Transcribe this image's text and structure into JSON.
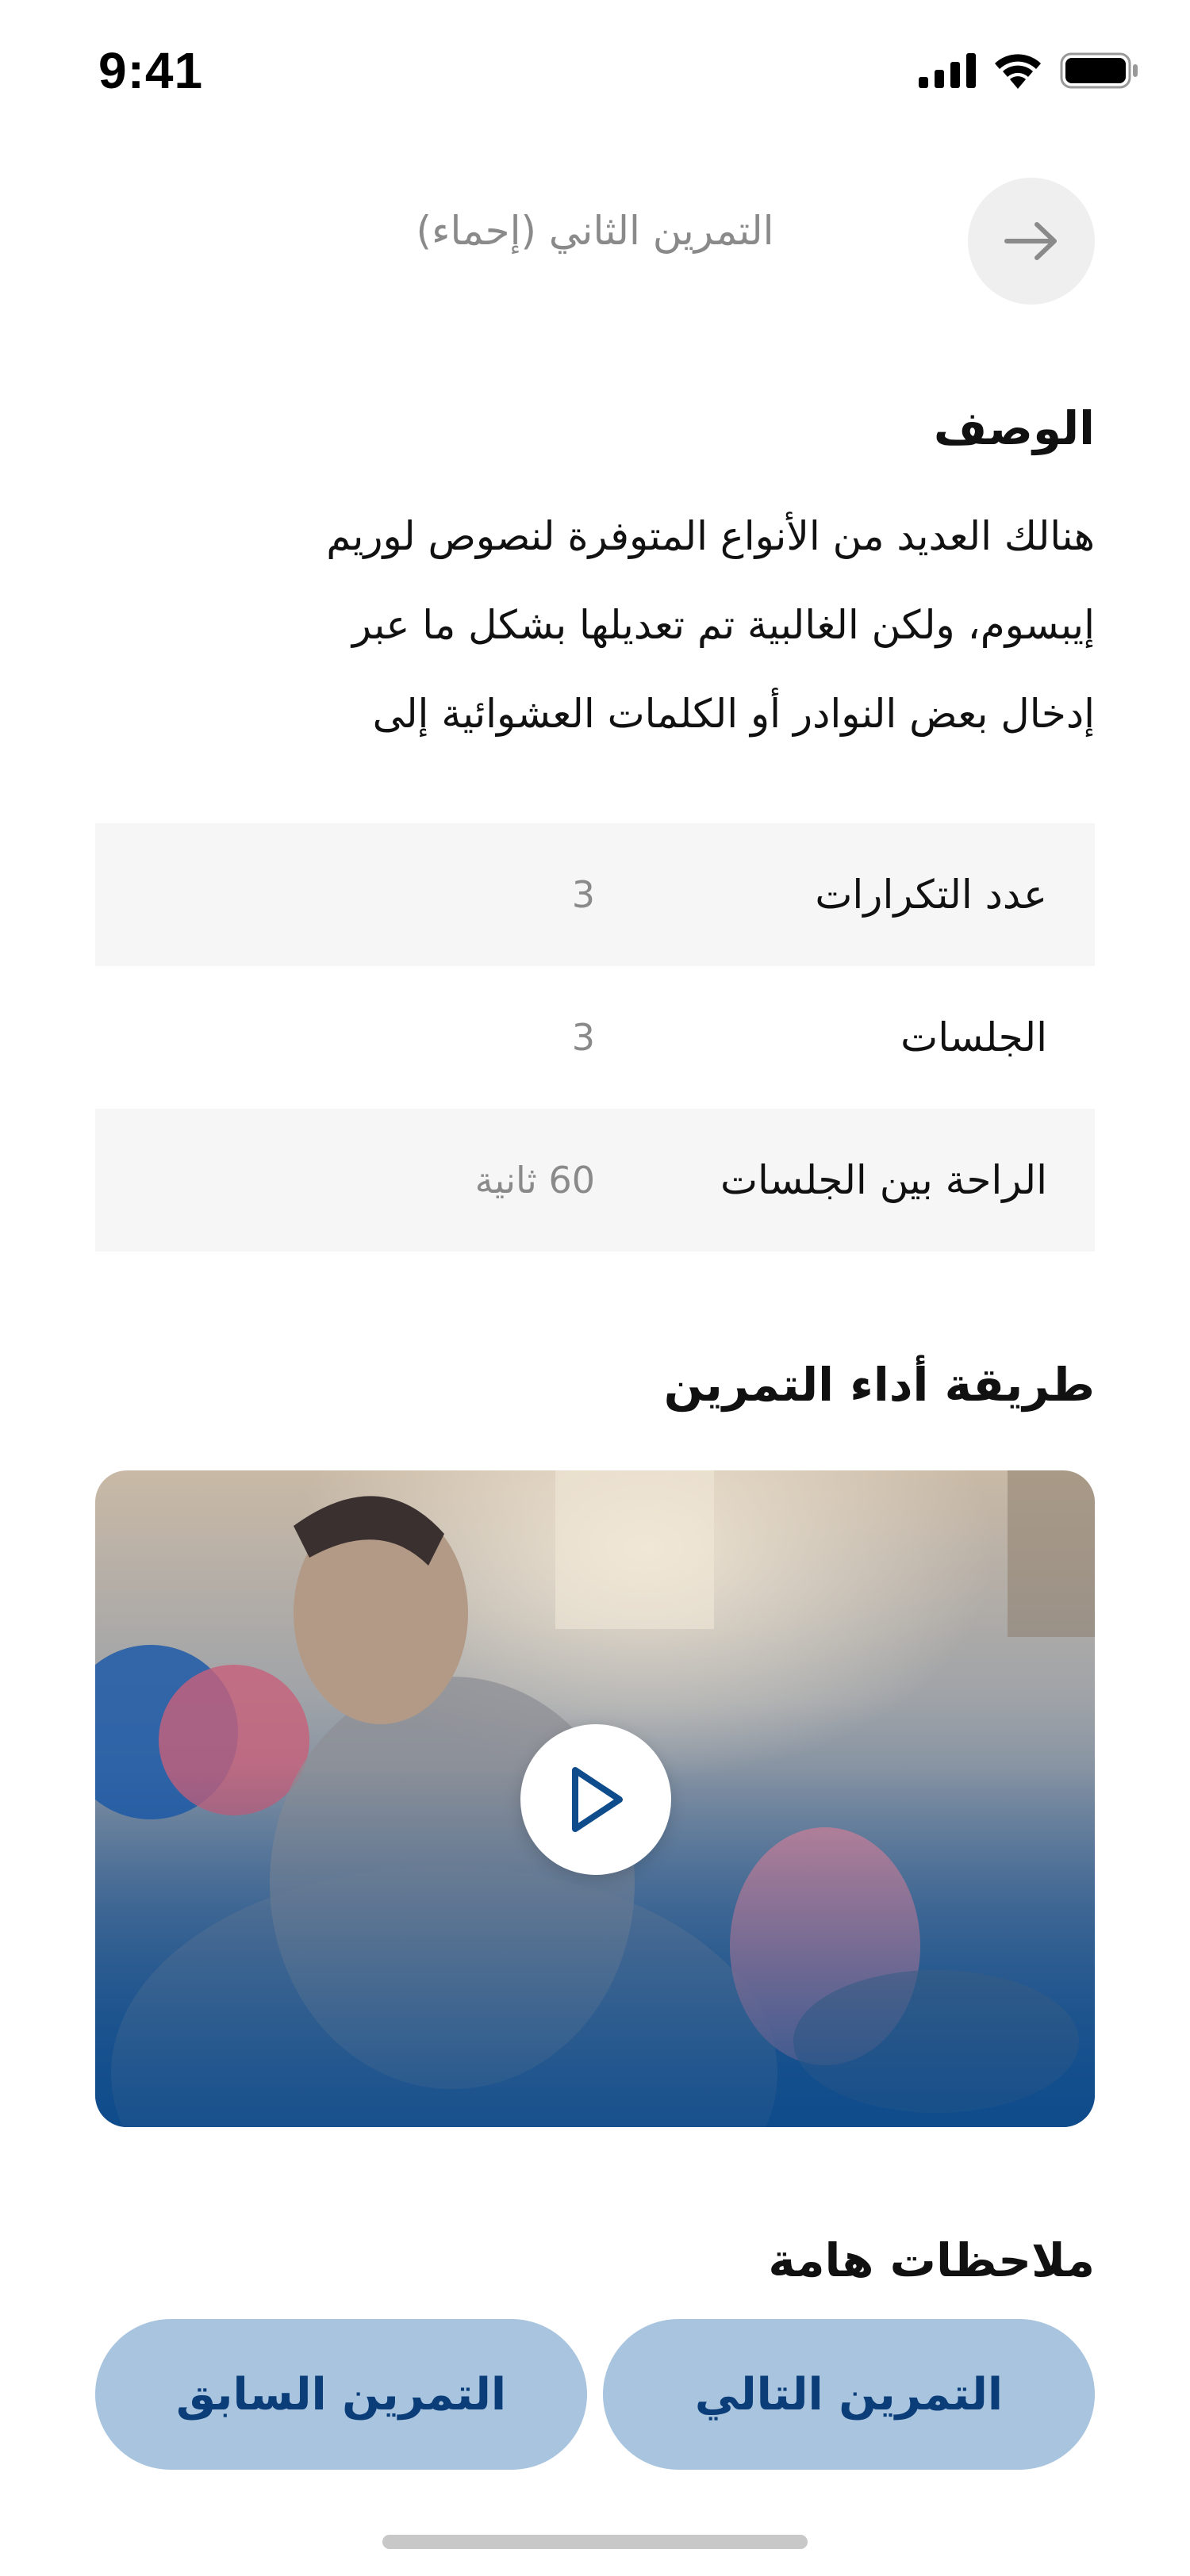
{
  "status_bar": {
    "time": "9:41"
  },
  "header": {
    "title": "التمرين الثاني (إحماء)"
  },
  "description": {
    "title": "الوصف",
    "lines": [
      "هنالك العديد من الأنواع المتوفرة لنصوص لوريم",
      "إيبسوم، ولكن الغالبية تم تعديلها بشكل ما عبر",
      "إدخال بعض النوادر أو الكلمات العشوائية إلى"
    ]
  },
  "info": {
    "rows": [
      {
        "label": "عدد التكرارات",
        "value": "3"
      },
      {
        "label": "الجلسات",
        "value": "3"
      },
      {
        "label": "الراحة بين الجلسات",
        "value": "60 ثانية"
      }
    ]
  },
  "how_to": {
    "title": "طريقة أداء التمرين"
  },
  "notes": {
    "title": "ملاحظات هامة"
  },
  "buttons": {
    "next": "التمرين التالي",
    "previous": "التمرين السابق"
  },
  "colors": {
    "button_bg": "#a8c4df",
    "button_text": "#0b3d78",
    "play_icon": "#0f4c8c"
  },
  "icons": [
    "signal-icon",
    "wifi-icon",
    "battery-icon",
    "arrow-right-icon",
    "play-icon"
  ]
}
